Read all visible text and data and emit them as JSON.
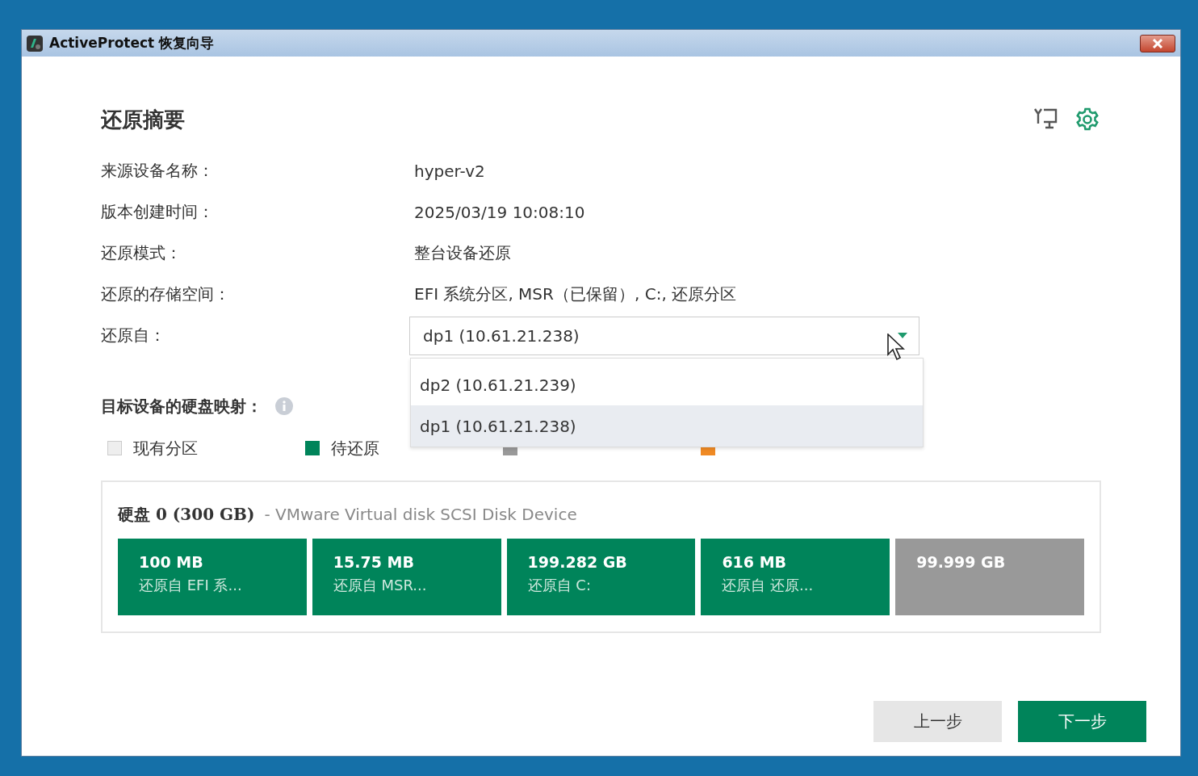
{
  "window": {
    "title": "ActiveProtect 恢复向导"
  },
  "heading": "还原摘要",
  "summary": [
    {
      "label": "来源设备名称：",
      "value": "hyper-v2"
    },
    {
      "label": "版本创建时间：",
      "value": "2025/03/19 10:08:10"
    },
    {
      "label": "还原模式：",
      "value": "整台设备还原"
    },
    {
      "label": "还原的存储空间：",
      "value": "EFI 系统分区, MSR（已保留）, C:, 还原分区"
    }
  ],
  "restore_from": {
    "label": "还原自：",
    "value": "dp1 (10.61.21.238)",
    "expanded": true,
    "options": [
      {
        "label": "dp2 (10.61.21.239)",
        "selected": false
      },
      {
        "label": "dp1 (10.61.21.238)",
        "selected": true
      }
    ]
  },
  "mapping": {
    "title": "目标设备的硬盘映射：",
    "legend": [
      {
        "label": "现有分区",
        "color": "#eeeeee"
      },
      {
        "label": "待还原",
        "color": "#00845a"
      },
      {
        "color": "#999999"
      },
      {
        "color": "#f08a24"
      }
    ]
  },
  "disk": {
    "name": "硬盘 0 (300 GB)",
    "device": "- VMware Virtual disk SCSI Disk Device",
    "partitions": [
      {
        "kind": "restore",
        "size": "100 MB",
        "source": "还原自  EFI 系..."
      },
      {
        "kind": "restore",
        "size": "15.75 MB",
        "source": "还原自  MSR..."
      },
      {
        "kind": "restore",
        "size": "199.282 GB",
        "source": "还原自  C:"
      },
      {
        "kind": "restore",
        "size": "616 MB",
        "source": "还原自  还原..."
      },
      {
        "kind": "unallocated",
        "size": "99.999 GB"
      }
    ]
  },
  "buttons": [
    {
      "label": "上一步",
      "kind": "secondary"
    },
    {
      "label": "下一步",
      "kind": "primary"
    }
  ]
}
